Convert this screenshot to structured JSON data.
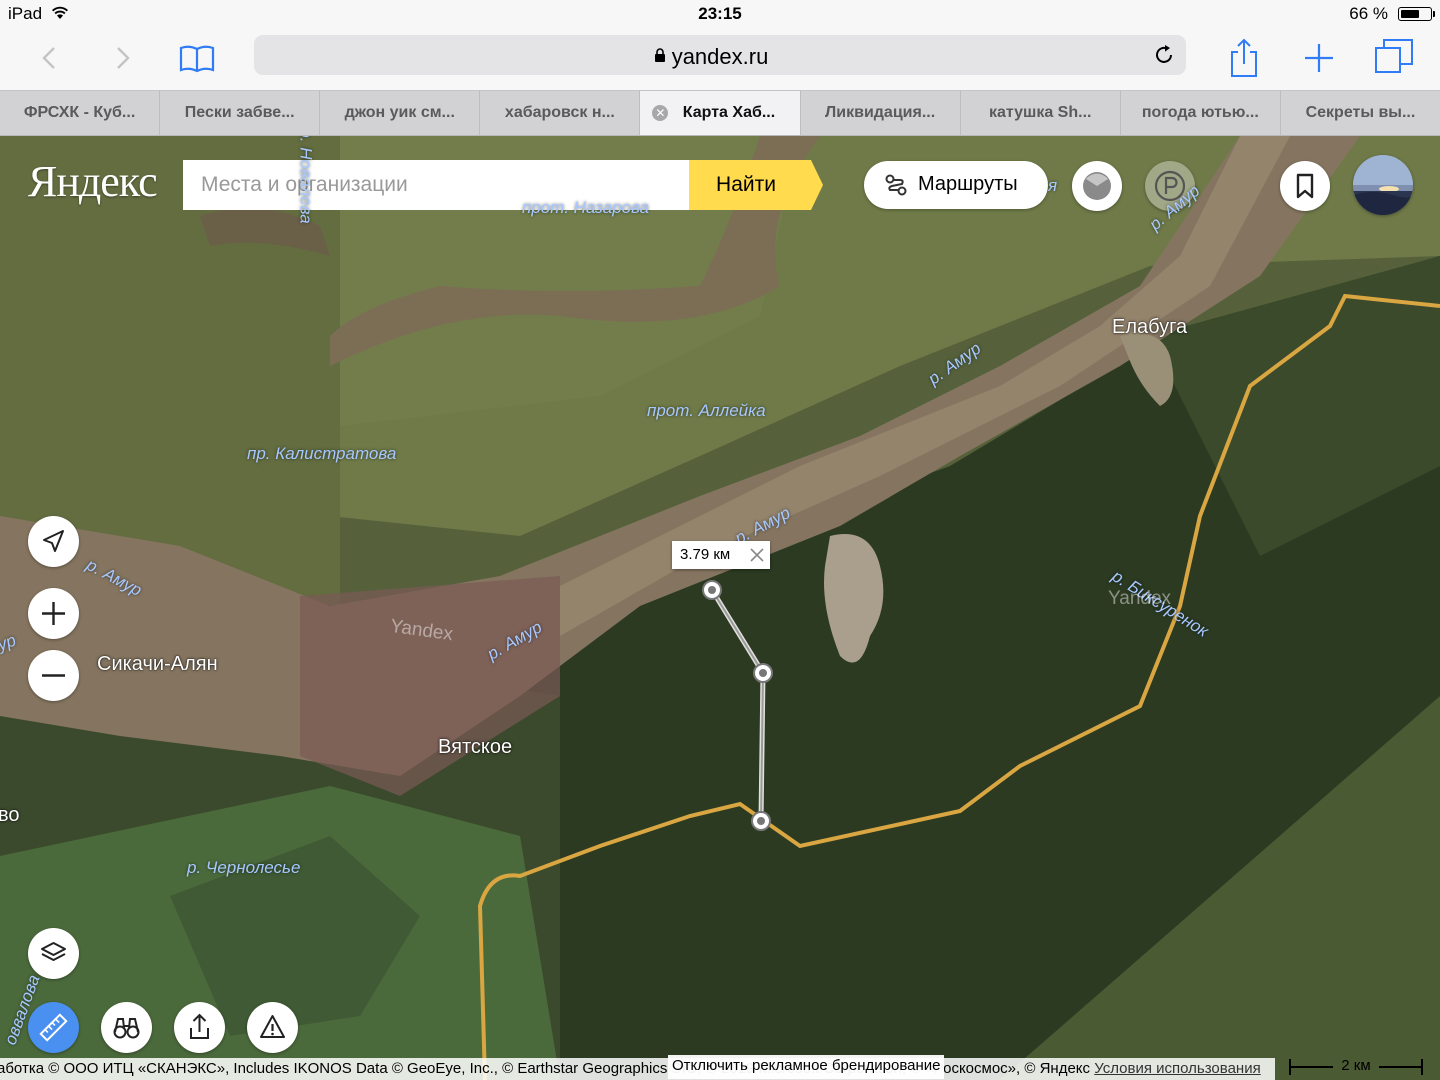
{
  "status": {
    "device": "iPad",
    "time": "23:15",
    "battery": "66 %",
    "battery_level": 0.66
  },
  "browser": {
    "url": "yandex.ru",
    "tabs": [
      {
        "title": "ФРСХК - Куб...",
        "active": false
      },
      {
        "title": "Пески забве...",
        "active": false
      },
      {
        "title": "джон уик см...",
        "active": false
      },
      {
        "title": "хабаровск н...",
        "active": false
      },
      {
        "title": "Карта Хаб...",
        "active": true
      },
      {
        "title": "Ликвидация...",
        "active": false
      },
      {
        "title": "катушка Sh...",
        "active": false
      },
      {
        "title": "погода ютью...",
        "active": false
      },
      {
        "title": "Секреты вы...",
        "active": false
      }
    ]
  },
  "map": {
    "logo": "Яндекс",
    "search_placeholder": "Места и организации",
    "search_button": "Найти",
    "routes_button": "Маршруты",
    "places": {
      "elabuga": "Елабуга",
      "sikachi": "Сикачи-Алян",
      "vyatskoe": "Вятское",
      "edge_vo": "во"
    },
    "water": {
      "amur1": "р. Амур",
      "amur2": "р. Амур",
      "amur3": "р. Амур",
      "amur4": "р. Амур",
      "amur5": "р. Амур",
      "amur6": "ур",
      "alleyka": "прот. Аллейка",
      "kalistratova": "пр. Калистратова",
      "bikhsurenok": "р. Биксуренок",
      "chernolesye": "р. Чернолесье",
      "novalova": "оввалова",
      "nazarova": "прот. Назарова",
      "top_vertical": "р. Новалева",
      "edge_ya": "я"
    },
    "watermarks": [
      "Yandex",
      "Yandex"
    ],
    "distance": "3.79 км",
    "footer_copyright": "аботка © ООО ИТЦ «СКАНЭКС», Includes IKONOS Data © GeoEye, Inc., © Earthstar Geographics SIO, © 2019 Microsoft Corporation, © «Роскосмос», © Яндекс",
    "footer_terms": "Условия использования",
    "brand_off": "Отключить рекламное брендирование",
    "scale": "2 км"
  }
}
